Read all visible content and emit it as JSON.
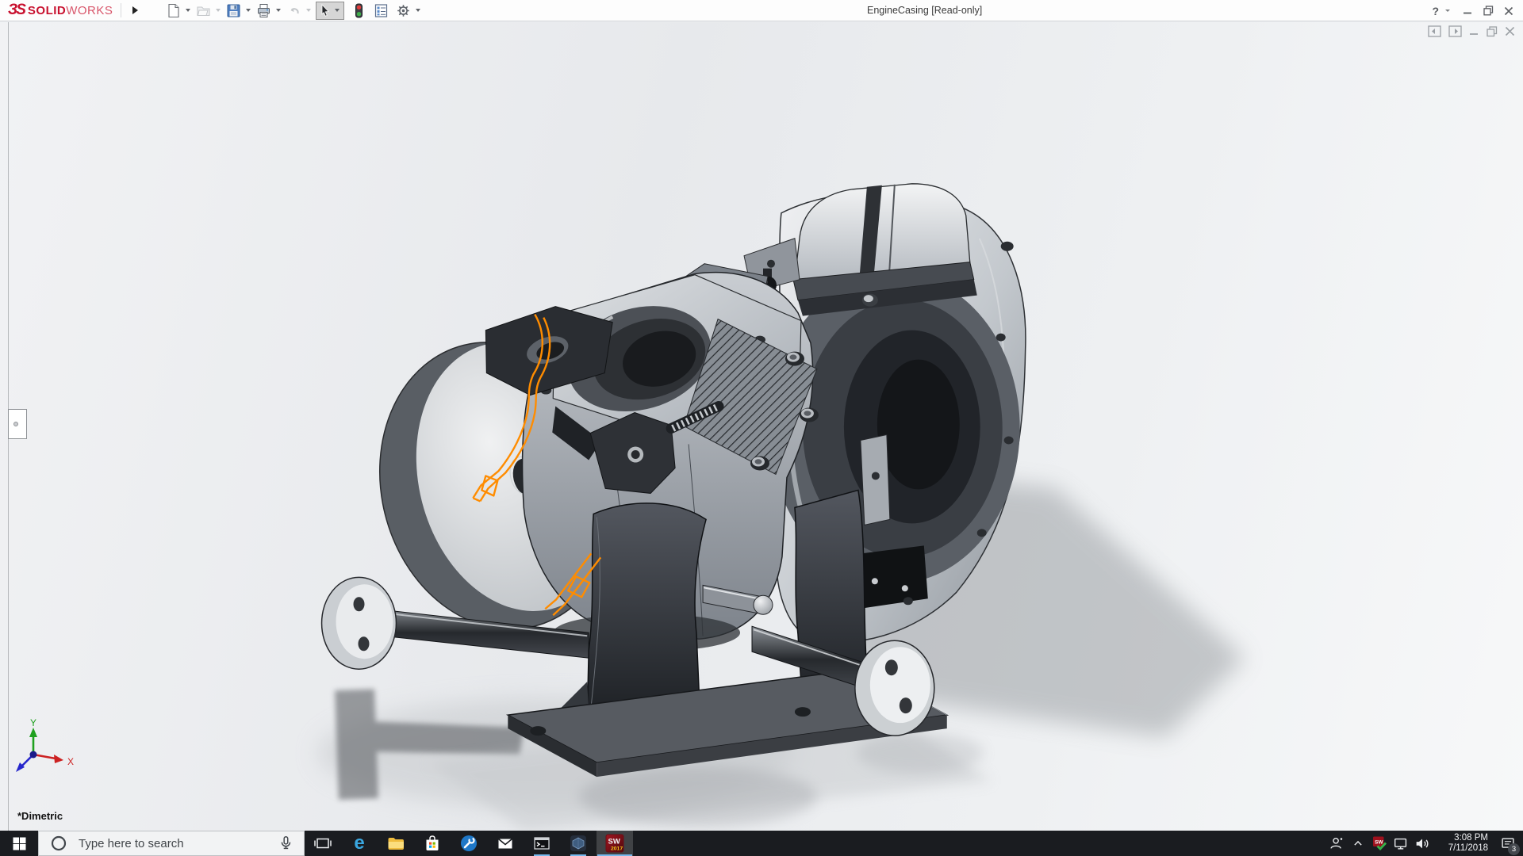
{
  "titlebar": {
    "logo": {
      "mark": "ЗS",
      "solid": "SOLID",
      "works": "WORKS"
    },
    "document_title": "EngineCasing [Read-only]",
    "help_glyph": "?",
    "toolbar_icons": [
      "new-document",
      "open",
      "save",
      "print",
      "undo",
      "select",
      "rebuild",
      "file-properties",
      "options"
    ]
  },
  "doc_window_controls": [
    "pane-left",
    "pane-right",
    "minimize",
    "restore",
    "close"
  ],
  "viewport": {
    "orientation_label": "*Dimetric",
    "triad": {
      "x_label": "X",
      "y_label": "Y"
    }
  },
  "taskbar": {
    "search_placeholder": "Type here to search",
    "edge_glyph": "e",
    "app_icons": [
      "task-view",
      "edge",
      "file-explorer",
      "microsoft-store",
      "settings",
      "mail",
      "command-prompt",
      "modeling-app",
      "solidworks-2017"
    ],
    "solidworks_icon": {
      "line1": "SW",
      "line2": "2017"
    },
    "tray": {
      "sw_badge_label": "SW",
      "time": "3:08 PM",
      "date": "7/11/2018",
      "notification_count": "3"
    }
  },
  "colors": {
    "brand_red": "#c8102e",
    "selection_orange": "#ff8c00",
    "taskbar_bg": "#1a1c20",
    "open_indicator_blue": "#76b9ed"
  }
}
